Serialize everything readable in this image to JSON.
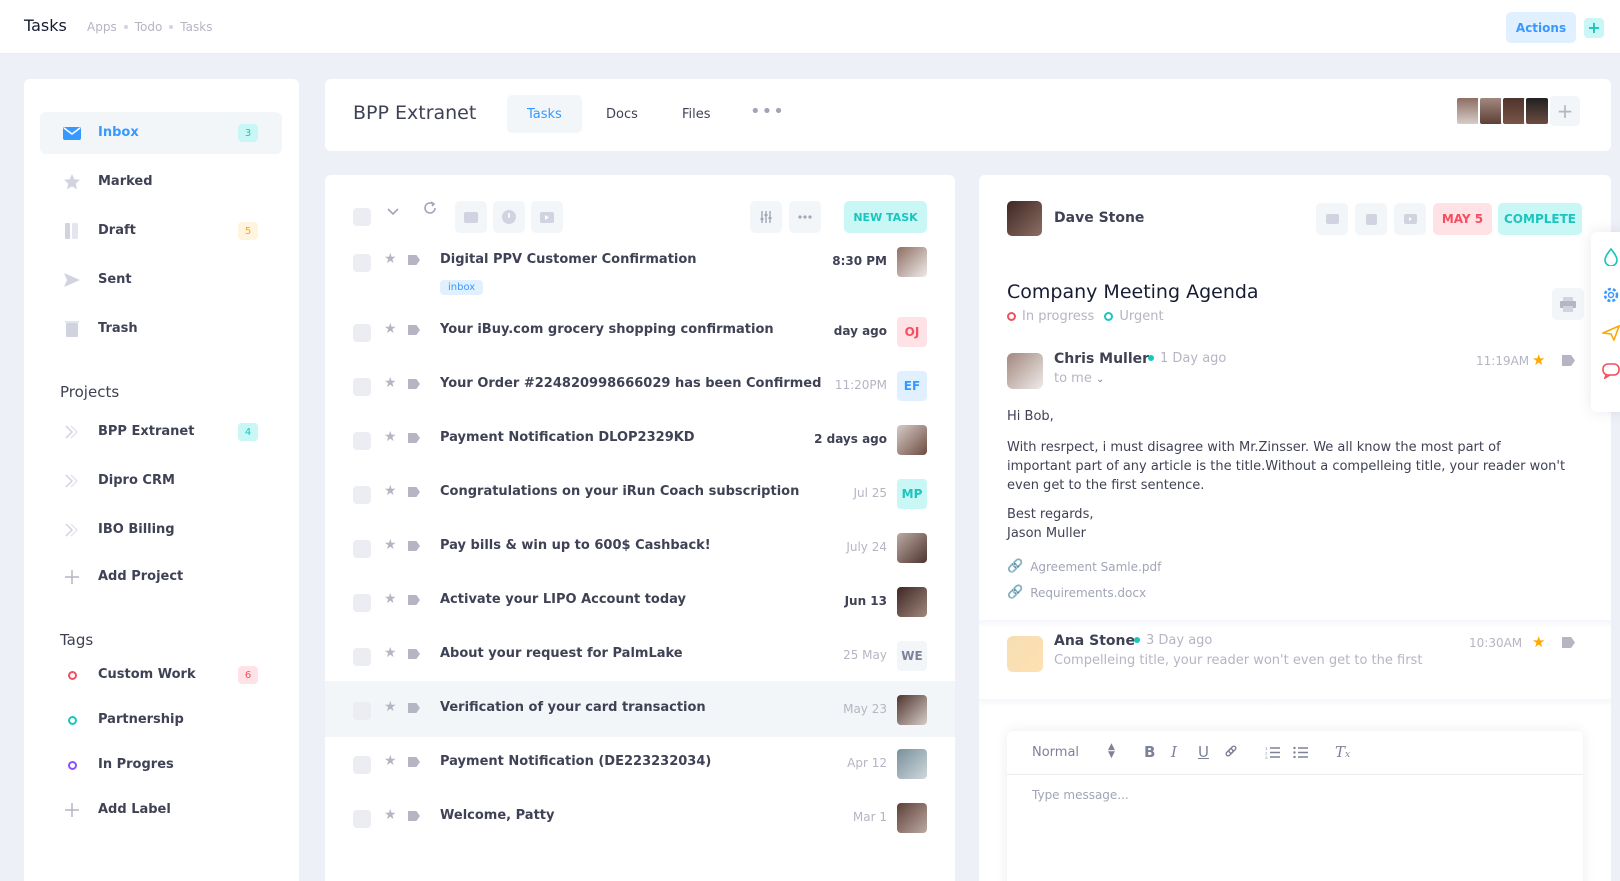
{
  "header": {
    "title": "Tasks",
    "breadcrumbs": [
      "Apps",
      "Todo",
      "Tasks"
    ],
    "actions_label": "Actions",
    "add_label": "+"
  },
  "sidebar": {
    "items": [
      {
        "label": "Inbox",
        "badge": "3"
      },
      {
        "label": "Marked"
      },
      {
        "label": "Draft",
        "badge": "5"
      },
      {
        "label": "Sent"
      },
      {
        "label": "Trash"
      }
    ],
    "projects_title": "Projects",
    "projects": [
      {
        "label": "BPP Extranet",
        "badge": "4"
      },
      {
        "label": "Dipro CRM"
      },
      {
        "label": "IBO Billing"
      },
      {
        "label": "Add Project"
      }
    ],
    "tags_title": "Tags",
    "tags": [
      {
        "label": "Custom Work",
        "badge": "6",
        "color": "#f64e60"
      },
      {
        "label": "Partnership",
        "color": "#1bc5bd"
      },
      {
        "label": "In Progres",
        "color": "#8950fc"
      },
      {
        "label": "Add Label"
      }
    ]
  },
  "project": {
    "title": "BPP Extranet",
    "tabs": [
      "Tasks",
      "Docs",
      "Files"
    ],
    "more": "•••",
    "add_member": "+"
  },
  "list": {
    "new_task_label": "NEW TASK",
    "rows": [
      {
        "subject": "Digital PPV Customer Confirmation",
        "time": "8:30 PM",
        "pill": "inbox",
        "avatar": "img",
        "dark": true
      },
      {
        "subject": "Your iBuy.com grocery shopping confirmation",
        "time": "day ago",
        "avatar": "OJ",
        "dark": true
      },
      {
        "subject": "Your Order #224820998666029 has been Confirmed",
        "time": "11:20PM",
        "avatar": "EF"
      },
      {
        "subject": "Payment Notification DLOP2329KD",
        "time": "2 days ago",
        "avatar": "img",
        "dark": true
      },
      {
        "subject": "Congratulations on your iRun Coach subscription",
        "time": "Jul 25",
        "avatar": "MP"
      },
      {
        "subject": "Pay bills & win up to 600$ Cashback!",
        "time": "July 24",
        "avatar": "img"
      },
      {
        "subject": "Activate your LIPO Account today",
        "time": "Jun 13",
        "avatar": "img",
        "dark": true
      },
      {
        "subject": "About your request for PalmLake",
        "time": "25 May",
        "avatar": "WE"
      },
      {
        "subject": "Verification of your card transaction",
        "time": "May 23",
        "avatar": "img"
      },
      {
        "subject": "Payment Notification (DE223232034)",
        "time": "Apr 12",
        "avatar": "img"
      },
      {
        "subject": "Welcome, Patty",
        "time": "Mar 1",
        "avatar": "img"
      }
    ]
  },
  "detail": {
    "sender": "Dave Stone",
    "date_badge": "MAY 5",
    "complete_label": "COMPLETE",
    "title": "Company Meeting Agenda",
    "status_1": "In progress",
    "status_2": "Urgent",
    "message": {
      "name": "Chris Muller",
      "when": "1 Day ago",
      "to": "to me",
      "time": "11:19AM",
      "greeting": "Hi Bob,",
      "body": "With resrpect, i must disagree with Mr.Zinsser. We all know the most part of important part of any article is the title.Without a compelleing title, your reader won't even get to the first sentence.",
      "closing": "Best regards,",
      "signature": "Jason Muller",
      "attachments": [
        "Agreement Samle.pdf",
        "Requirements.docx"
      ]
    },
    "reply": {
      "name": "Ana Stone",
      "when": "3 Day ago",
      "time": "10:30AM",
      "preview": "Compelleing title, your reader won't even get to the first"
    },
    "editor": {
      "format": "Normal",
      "placeholder": "Type message..."
    }
  }
}
